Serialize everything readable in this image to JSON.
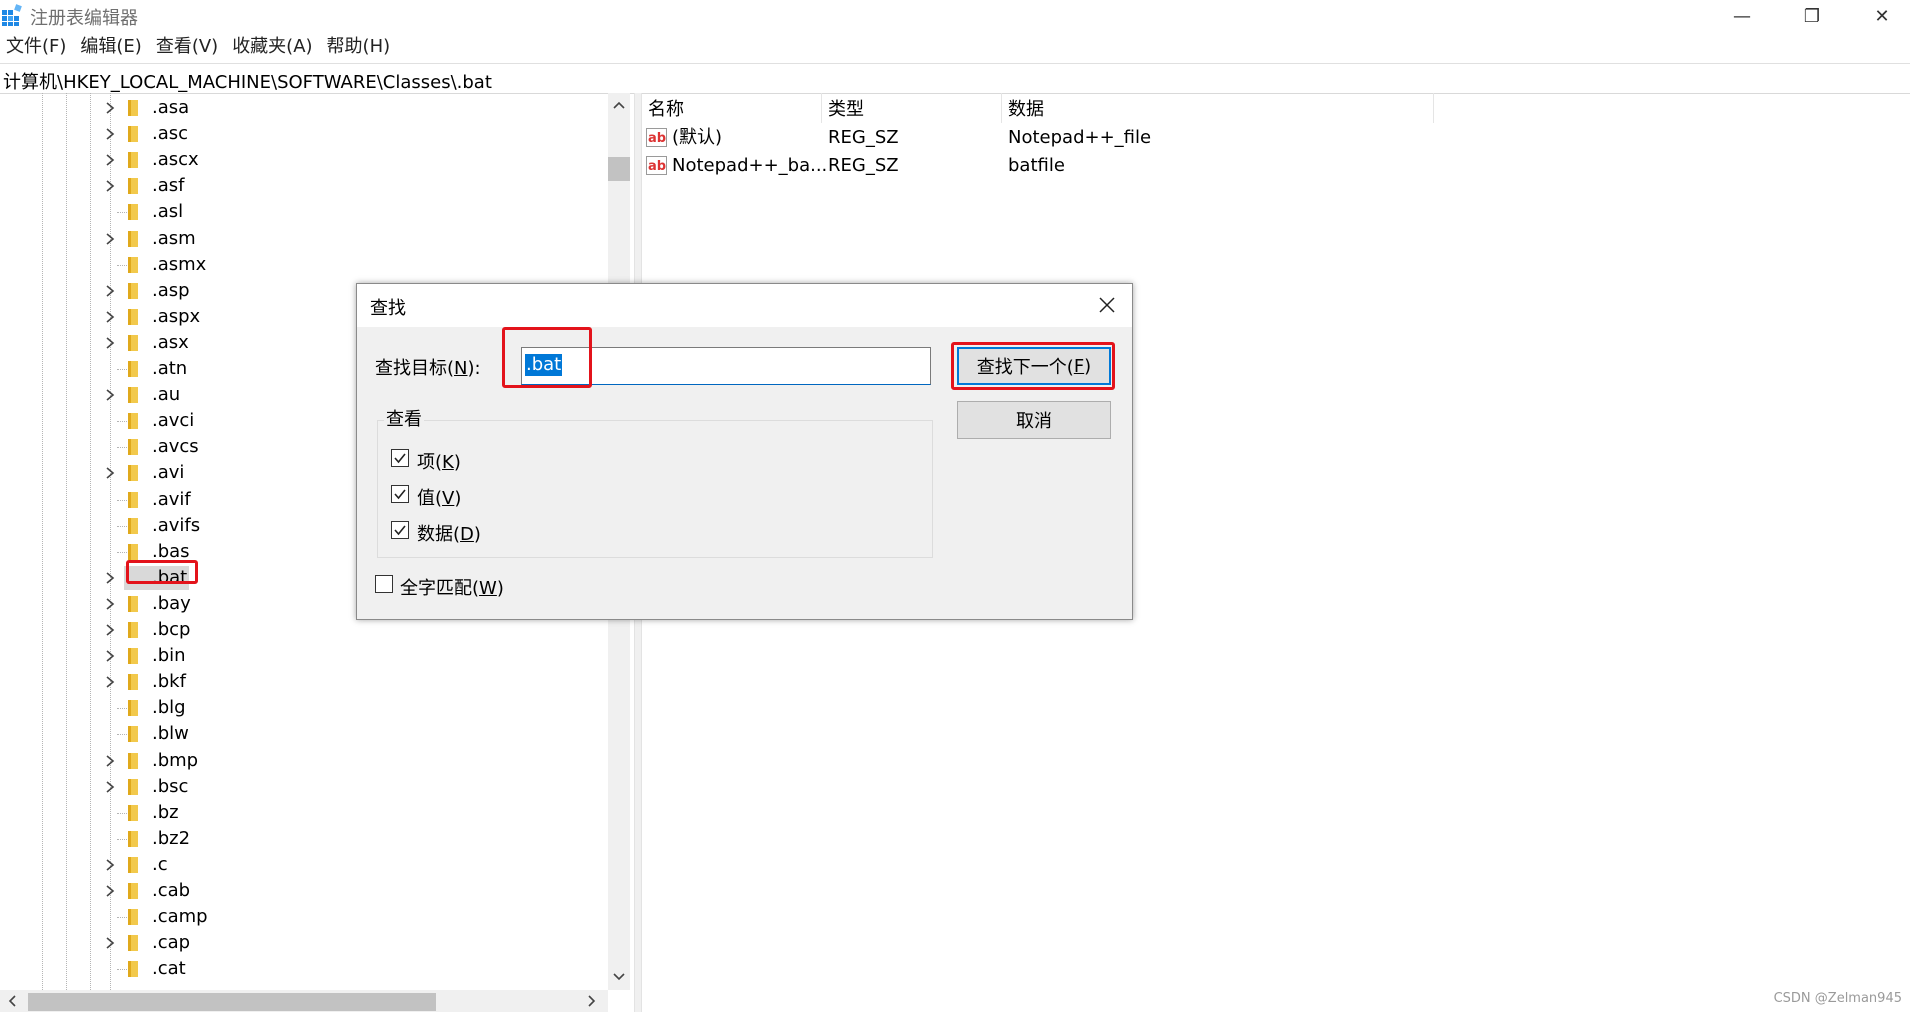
{
  "window": {
    "title": "注册表编辑器",
    "minimize_glyph": "—",
    "restore_glyph": "❐",
    "close_glyph": "✕"
  },
  "menu": [
    "文件(F)",
    "编辑(E)",
    "查看(V)",
    "收藏夹(A)",
    "帮助(H)"
  ],
  "address": "计算机\\HKEY_LOCAL_MACHINE\\SOFTWARE\\Classes\\.bat",
  "tree": {
    "items": [
      {
        "label": ".asa",
        "expandable": true
      },
      {
        "label": ".asc",
        "expandable": true
      },
      {
        "label": ".ascx",
        "expandable": true
      },
      {
        "label": ".asf",
        "expandable": true
      },
      {
        "label": ".asl",
        "expandable": false
      },
      {
        "label": ".asm",
        "expandable": true
      },
      {
        "label": ".asmx",
        "expandable": false
      },
      {
        "label": ".asp",
        "expandable": true
      },
      {
        "label": ".aspx",
        "expandable": true
      },
      {
        "label": ".asx",
        "expandable": true
      },
      {
        "label": ".atn",
        "expandable": false
      },
      {
        "label": ".au",
        "expandable": true
      },
      {
        "label": ".avci",
        "expandable": false
      },
      {
        "label": ".avcs",
        "expandable": false
      },
      {
        "label": ".avi",
        "expandable": true
      },
      {
        "label": ".avif",
        "expandable": false
      },
      {
        "label": ".avifs",
        "expandable": false
      },
      {
        "label": ".bas",
        "expandable": false
      },
      {
        "label": ".bat",
        "expandable": true,
        "selected": true
      },
      {
        "label": ".bay",
        "expandable": true
      },
      {
        "label": ".bcp",
        "expandable": true
      },
      {
        "label": ".bin",
        "expandable": true
      },
      {
        "label": ".bkf",
        "expandable": true
      },
      {
        "label": ".blg",
        "expandable": false
      },
      {
        "label": ".blw",
        "expandable": false
      },
      {
        "label": ".bmp",
        "expandable": true
      },
      {
        "label": ".bsc",
        "expandable": true
      },
      {
        "label": ".bz",
        "expandable": false
      },
      {
        "label": ".bz2",
        "expandable": false
      },
      {
        "label": ".c",
        "expandable": true
      },
      {
        "label": ".cab",
        "expandable": true
      },
      {
        "label": ".camp",
        "expandable": false
      },
      {
        "label": ".cap",
        "expandable": true
      },
      {
        "label": ".cat",
        "expandable": false
      }
    ]
  },
  "list": {
    "columns": [
      "名称",
      "类型",
      "数据"
    ],
    "rows": [
      {
        "name": "(默认)",
        "type": "REG_SZ",
        "data": "Notepad++_file"
      },
      {
        "name": "Notepad++_ba...",
        "type": "REG_SZ",
        "data": "batfile"
      }
    ]
  },
  "find_dialog": {
    "title": "查找",
    "target_label": "查找目标(",
    "target_key": "N",
    "target_suffix": "):",
    "target_value": ".bat",
    "find_next_label": "查找下一个(",
    "find_next_key": "F",
    "find_next_suffix": ")",
    "cancel_label": "取消",
    "look_at_label": "查看",
    "options": [
      {
        "label": "项(",
        "key": "K",
        "suffix": ")",
        "checked": true
      },
      {
        "label": "值(",
        "key": "V",
        "suffix": ")",
        "checked": true
      },
      {
        "label": "数据(",
        "key": "D",
        "suffix": ")",
        "checked": true
      }
    ],
    "match_whole": {
      "label": "全字匹配(",
      "key": "W",
      "suffix": ")",
      "checked": false
    }
  },
  "colors": {
    "highlight_red": "#e3131b",
    "selection_blue": "#0078d7",
    "folder_yellow": "#f2c94c"
  },
  "watermark": "CSDN @Zelman945"
}
